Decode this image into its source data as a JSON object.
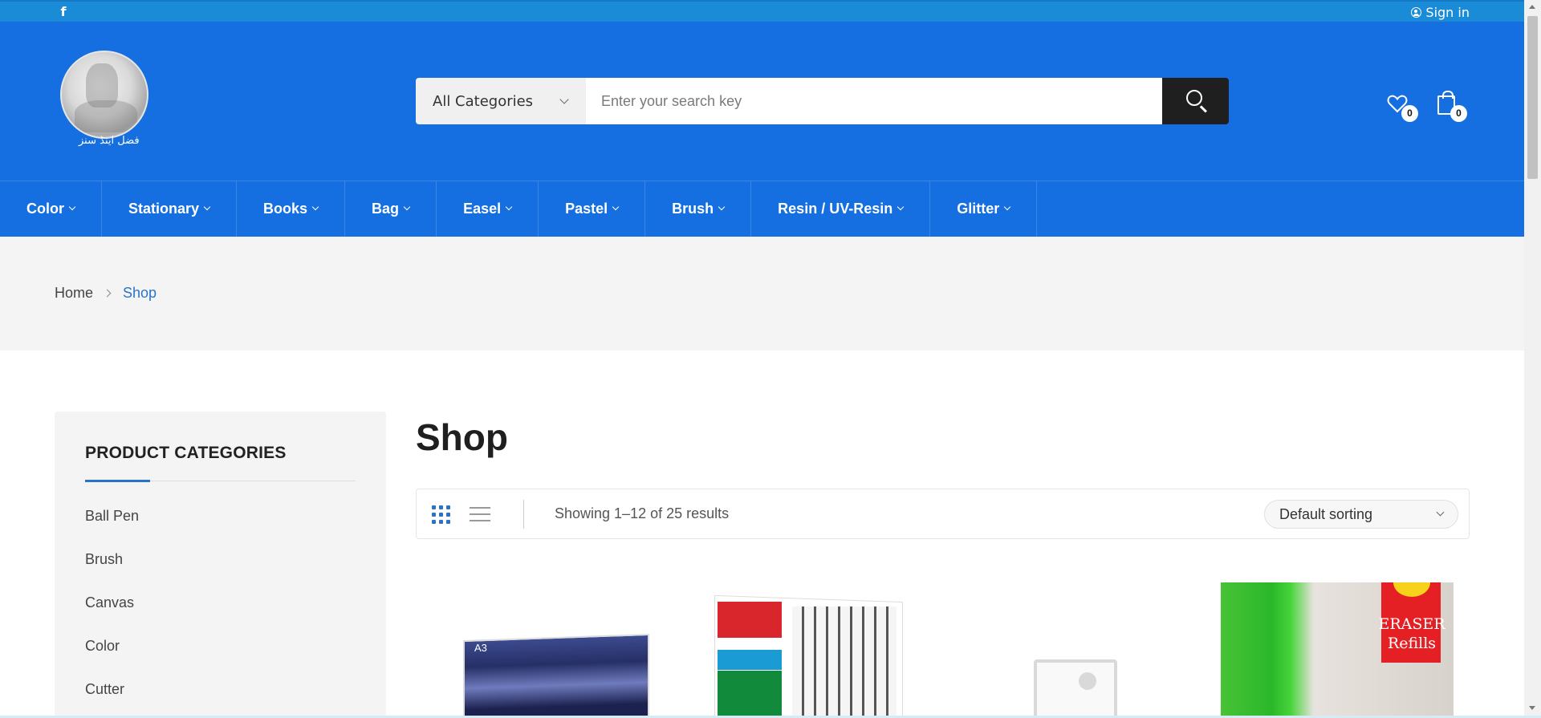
{
  "topbar": {
    "social_icon": "facebook-icon",
    "signin_label": "Sign in"
  },
  "header": {
    "logo_caption": "فضل اینڈ سنز",
    "search": {
      "category_label": "All Categories",
      "placeholder": "Enter your search key"
    },
    "wishlist_count": "0",
    "cart_count": "0"
  },
  "nav": {
    "items": [
      "Color",
      "Stationary",
      "Books",
      "Bag",
      "Easel",
      "Pastel",
      "Brush",
      "Resin / UV-Resin",
      "Glitter"
    ]
  },
  "breadcrumb": {
    "home": "Home",
    "current": "Shop"
  },
  "sidebar": {
    "title": "PRODUCT CATEGORIES",
    "categories": [
      "Ball Pen",
      "Brush",
      "Canvas",
      "Color",
      "Cutter"
    ]
  },
  "main": {
    "title": "Shop",
    "result_count": "Showing 1–12 of 25 results",
    "sort_label": "Default sorting"
  },
  "products": {
    "p1_tag": "A3",
    "p4_label": "ERASER Refills"
  },
  "colors": {
    "topbar": "#1a8bd6",
    "header": "#166fe0",
    "accent": "#2a73c9"
  }
}
